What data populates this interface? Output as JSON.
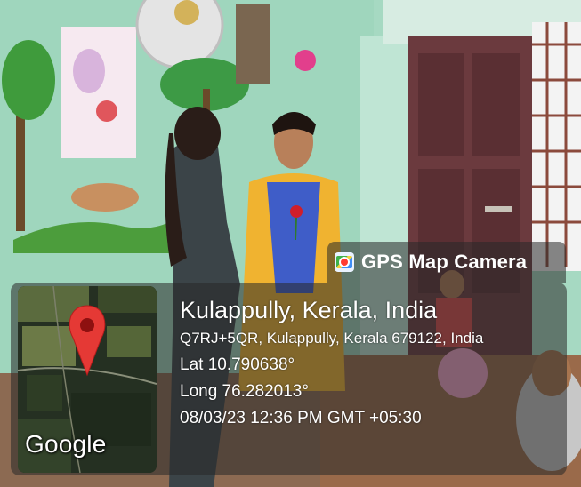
{
  "overlay": {
    "brand_label": "GPS Map Camera",
    "place_title": "Kulappully, Kerala, India",
    "address": "Q7RJ+5QR, Kulappully, Kerala 679122, India",
    "latitude": "Lat 10.790638°",
    "longitude": "Long 76.282013°",
    "datetime": "08/03/23 12:36 PM GMT +05:30",
    "map_logo_text": "Google",
    "icons": [
      "gps-map-camera-logo-icon",
      "map-pin-icon"
    ],
    "colors": {
      "overlay_bg": "#282828",
      "pin": "#e53935",
      "text": "#ffffff"
    }
  }
}
